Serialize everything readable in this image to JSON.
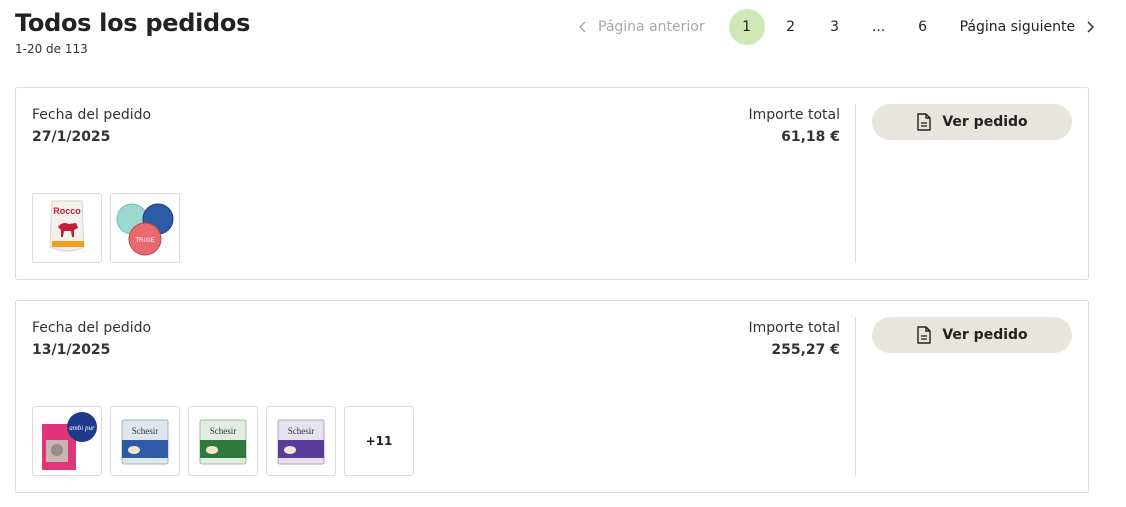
{
  "header": {
    "title": "Todos los pedidos",
    "count": "1-20 de 113"
  },
  "pagination": {
    "prev_label": "Página anterior",
    "next_label": "Página siguiente",
    "pages": [
      "1",
      "2",
      "3",
      "...",
      "6"
    ],
    "current": "1"
  },
  "orders": [
    {
      "date_label": "Fecha del pedido",
      "date": "27/1/2025",
      "total_label": "Importe total",
      "total": "61,18 €",
      "button_label": "Ver pedido",
      "thumbnails": [
        {
          "name": "rocco-dog-food-pouch",
          "brand": "Rocco"
        },
        {
          "name": "trixie-can-lids",
          "brand": "TRIXIE"
        }
      ]
    },
    {
      "date_label": "Fecha del pedido",
      "date": "13/1/2025",
      "total_label": "Importe total",
      "total": "255,27 €",
      "button_label": "Ver pedido",
      "thumbnails": [
        {
          "name": "ambi-pur-cat-litter",
          "brand": "ambi pur"
        },
        {
          "name": "schesir-can-blue",
          "brand": "Schesir"
        },
        {
          "name": "schesir-can-green",
          "brand": "Schesir"
        },
        {
          "name": "schesir-can-purple",
          "brand": "Schesir"
        }
      ],
      "more_label": "+11"
    }
  ],
  "colors": {
    "active_page": "#cfe8b6",
    "button_bg": "#e8e5de",
    "border": "#dcdcdc",
    "muted_text": "#a8a8a8"
  }
}
